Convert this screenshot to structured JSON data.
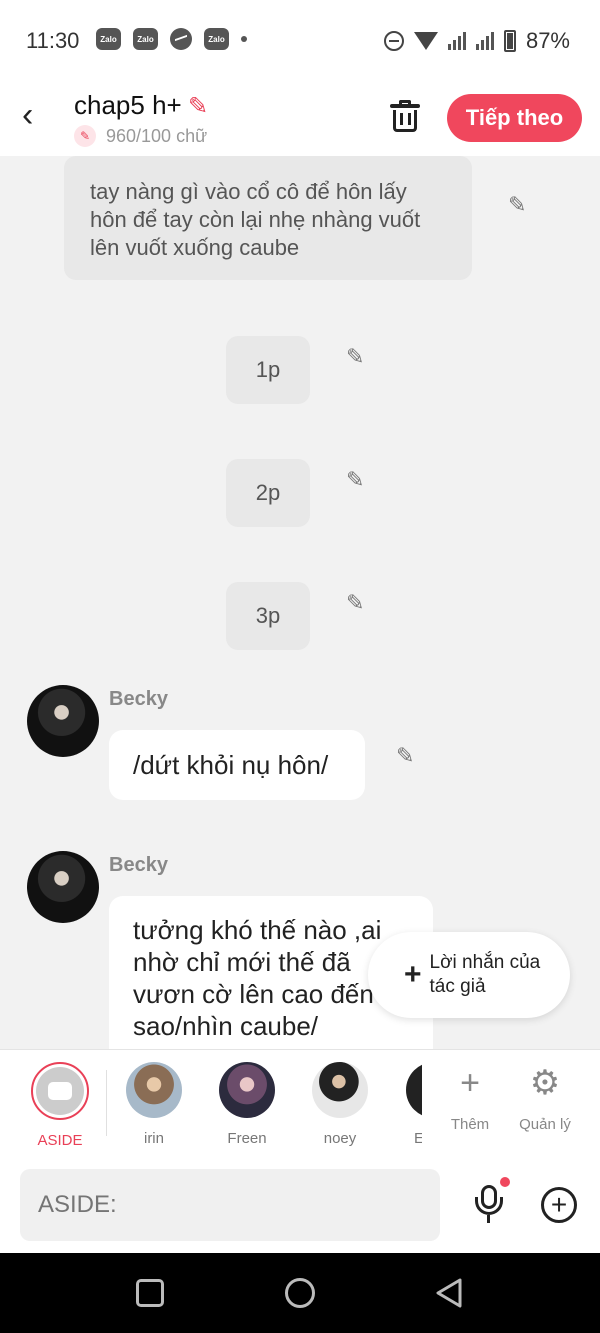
{
  "status_bar": {
    "time": "11:30",
    "app_icons": [
      "Zalo",
      "Zalo",
      "messenger-icon",
      "Zalo"
    ],
    "battery": "87%"
  },
  "header": {
    "title": "chap5 h+",
    "word_count": "960/100 chữ",
    "next_button": "Tiếp theo"
  },
  "messages": {
    "narration": "tay nàng gì vào cổ cô để hôn lấy hôn để tay còn lại nhẹ nhàng vuốt lên vuốt xuống caube",
    "short_items": [
      "1p",
      "2p",
      "3p"
    ],
    "chat": [
      {
        "sender": "Becky",
        "text": "/dứt khỏi nụ hôn/"
      },
      {
        "sender": "Becky",
        "text": "tưởng khó thế nào ,ai nhờ chỉ mới thế đã vươn cờ lên cao đến sao/nhìn caube/"
      }
    ]
  },
  "author_note": {
    "label": "Lời nhắn của tác giả"
  },
  "characters": {
    "aside": "ASIDE",
    "list": [
      "irin",
      "Freen",
      "noey",
      "E"
    ],
    "add_label": "Thêm",
    "manage_label": "Quản lý"
  },
  "input": {
    "placeholder": "ASIDE:"
  },
  "colors": {
    "accent": "#f0475d",
    "background": "#f2f2f2"
  }
}
